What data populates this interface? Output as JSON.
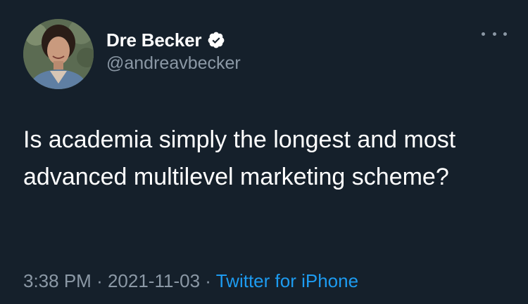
{
  "author": {
    "display_name": "Dre Becker",
    "handle": "@andreavbecker",
    "verified": true
  },
  "tweet": {
    "text": "Is academia simply the longest and most advanced multilevel marketing scheme?",
    "time": "3:38 PM",
    "date": "2021-11-03",
    "separator": "·",
    "source": "Twitter for iPhone"
  },
  "icons": {
    "verified": "verified-badge-icon",
    "more": "more-options-icon"
  },
  "colors": {
    "background": "#15202b",
    "primary_text": "#ffffff",
    "secondary_text": "#8b98a5",
    "link": "#1d9bf0"
  }
}
